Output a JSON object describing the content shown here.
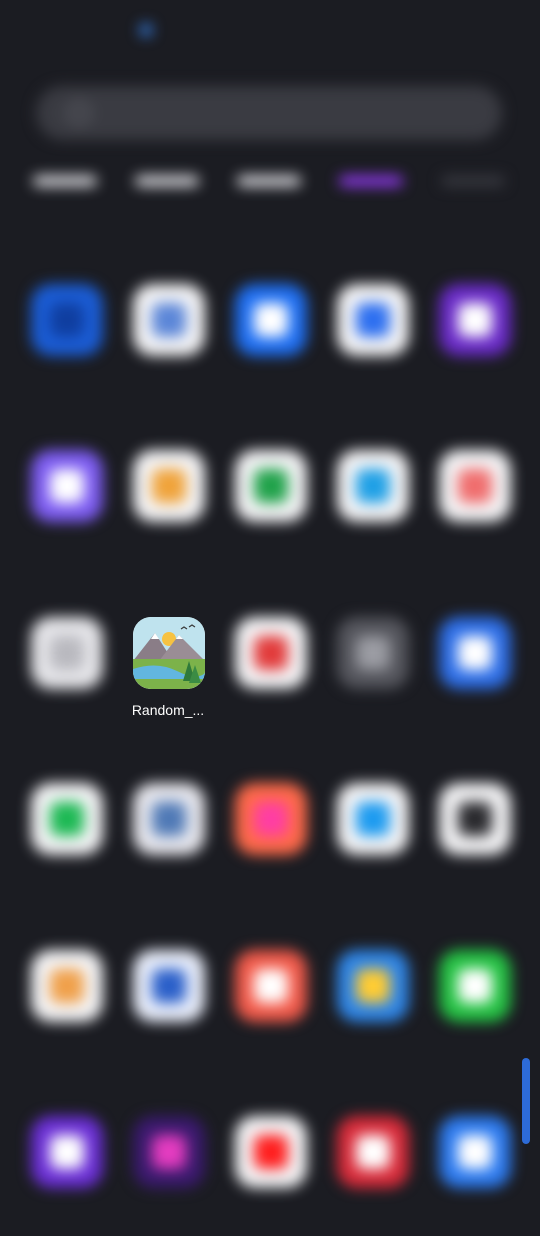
{
  "status_bar": {
    "left_text": "",
    "right_text": ""
  },
  "search": {
    "placeholder": ""
  },
  "top_row": [
    {
      "label": "",
      "bar": "light"
    },
    {
      "label": "",
      "bar": "light"
    },
    {
      "label": "",
      "bar": "light"
    },
    {
      "label": "",
      "bar": "purple"
    },
    {
      "label": "",
      "bar": "dark"
    }
  ],
  "apps": [
    {
      "label": "",
      "icon": "paypal-icon",
      "bg": "#1b5dd6",
      "fg": "#0f3ea0"
    },
    {
      "label": "",
      "icon": "card-icon",
      "bg": "#f4f4f6",
      "fg": "#5b86d8"
    },
    {
      "label": "",
      "icon": "phone-icon",
      "bg": "#1f6ff2",
      "fg": "#ffffff"
    },
    {
      "label": "",
      "icon": "shield-icon",
      "bg": "#f4f4f6",
      "fg": "#2d6ff0"
    },
    {
      "label": "",
      "icon": "phonepe-icon",
      "bg": "#6a2bc8",
      "fg": "#ffffff"
    },
    {
      "label": "",
      "icon": "photos-icon",
      "bg": "#7d5cf2",
      "fg": "#ffffff"
    },
    {
      "label": "",
      "icon": "google-photos-icon",
      "bg": "#f4f4f6",
      "fg": "#f0a33a"
    },
    {
      "label": "",
      "icon": "play-games-icon",
      "bg": "#f4f4f6",
      "fg": "#20a24a"
    },
    {
      "label": "",
      "icon": "play-store-icon",
      "bg": "#f4f4f6",
      "fg": "#1fa0e6"
    },
    {
      "label": "",
      "icon": "podcasts-icon",
      "bg": "#f4f4f6",
      "fg": "#f06d6d"
    },
    {
      "label": "",
      "icon": "qr-icon",
      "bg": "#e6e6ea",
      "fg": "#b9b9bf"
    },
    {
      "label": "Random_...",
      "icon": "landscape-icon",
      "bg": "#ffffff",
      "fg": "#ffffff",
      "sharp": true
    },
    {
      "label": "",
      "icon": "recorder-icon",
      "bg": "#f4f4f6",
      "fg": "#e23b3b"
    },
    {
      "label": "",
      "icon": "settings-icon",
      "bg": "#55565d",
      "fg": "#9b9ca3"
    },
    {
      "label": "",
      "icon": "signal-icon",
      "bg": "#2e6fe8",
      "fg": "#ffffff"
    },
    {
      "label": "",
      "icon": "spotify-icon",
      "bg": "#f4f4f6",
      "fg": "#1db954"
    },
    {
      "label": "",
      "icon": "telegram-icon",
      "bg": "#e8e8ee",
      "fg": "#4f79b6"
    },
    {
      "label": "",
      "icon": "theme-store-icon",
      "bg": "#ff6a4a",
      "fg": "#ff3ea3"
    },
    {
      "label": "",
      "icon": "twitter-icon",
      "bg": "#f4f4f6",
      "fg": "#1d9bf0"
    },
    {
      "label": "",
      "icon": "uber-icon",
      "bg": "#f4f4f6",
      "fg": "#2a2a2e"
    },
    {
      "label": "",
      "icon": "upi-icon",
      "bg": "#f4f4f6",
      "fg": "#f0a04a"
    },
    {
      "label": "",
      "icon": "opera-icon",
      "bg": "#e9eefb",
      "fg": "#2a5fc9"
    },
    {
      "label": "",
      "icon": "videos-icon",
      "bg": "#f25a4a",
      "fg": "#ffffff"
    },
    {
      "label": "",
      "icon": "weather-icon",
      "bg": "#2f86e8",
      "fg": "#ffcc33"
    },
    {
      "label": "",
      "icon": "whatsapp-icon",
      "bg": "#25c244",
      "fg": "#ffffff"
    },
    {
      "label": "",
      "icon": "yahoo-icon",
      "bg": "#6b2fd6",
      "fg": "#ffffff"
    },
    {
      "label": "",
      "icon": "zee-icon",
      "bg": "#3a1a6e",
      "fg": "#e43cc0"
    },
    {
      "label": "",
      "icon": "youtube-icon",
      "bg": "#f4f4f6",
      "fg": "#ff1f1f"
    },
    {
      "label": "",
      "icon": "zomato-icon",
      "bg": "#d92b3a",
      "fg": "#ffffff"
    },
    {
      "label": "",
      "icon": "zoom-icon",
      "bg": "#2d7bf0",
      "fg": "#ffffff"
    }
  ]
}
